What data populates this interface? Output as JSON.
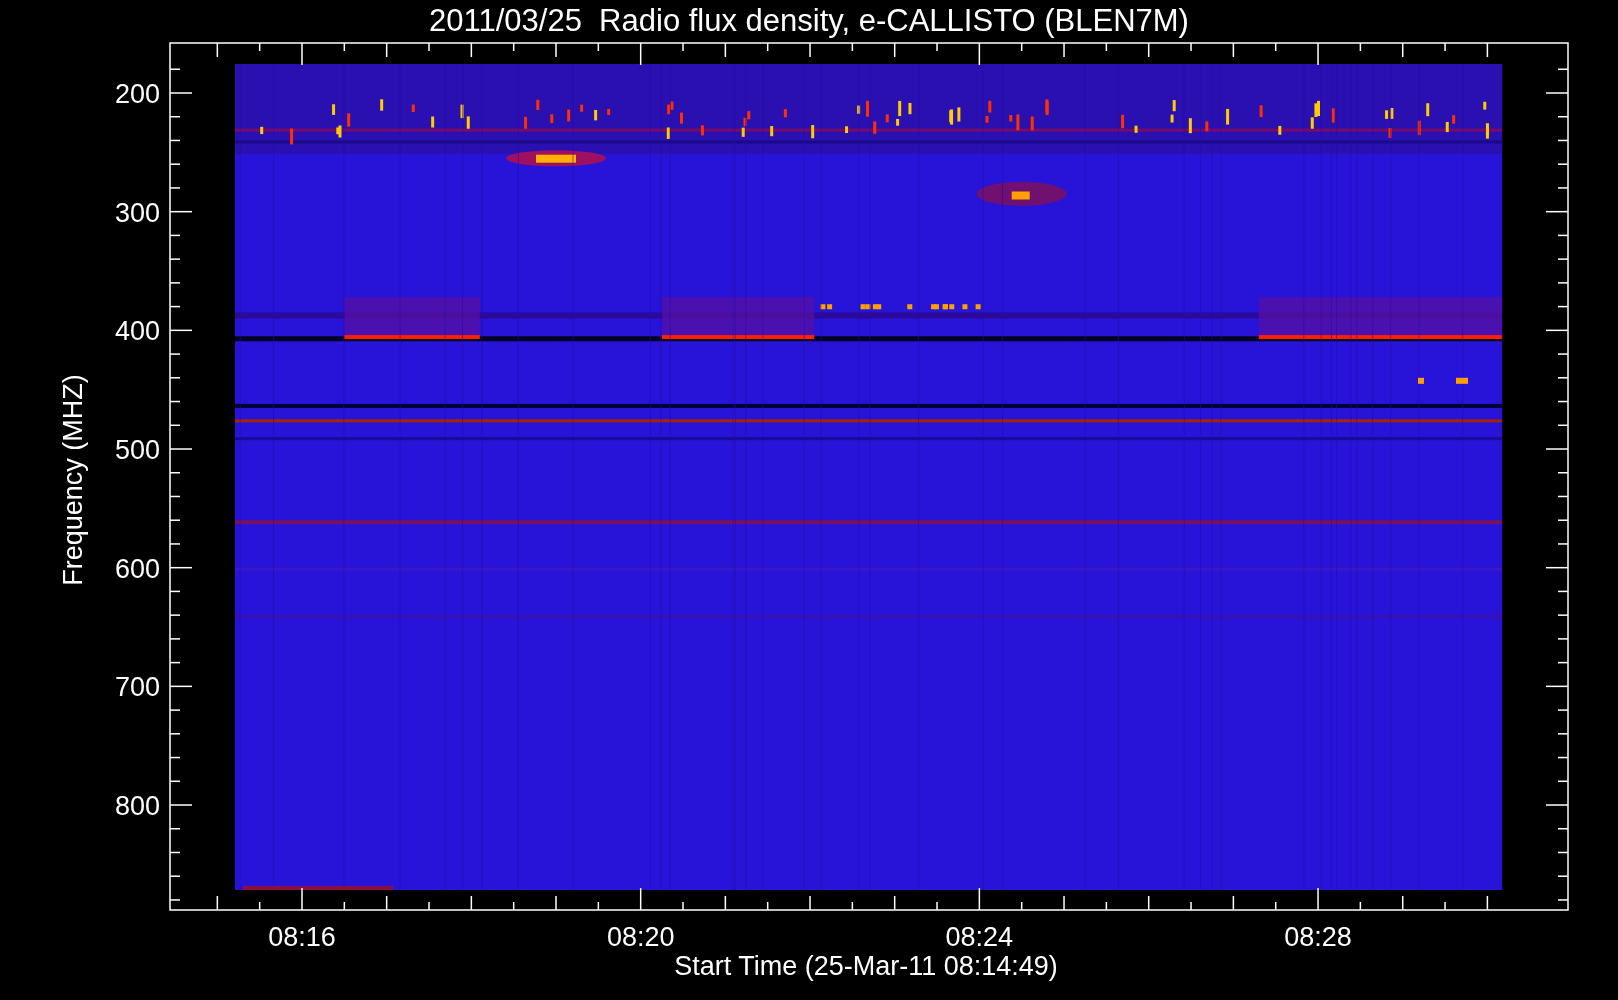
{
  "plot": {
    "title": "2011/03/25  Radio flux density, e-CALLISTO (BLEN7M)",
    "ylabel": "Frequency (MHZ)",
    "xlabel": "Start Time (25-Mar-11 08:14:49)",
    "yticks": [
      "200",
      "300",
      "400",
      "500",
      "600",
      "700",
      "800"
    ],
    "xticks": [
      "08:16",
      "08:20",
      "08:24",
      "08:28"
    ]
  }
}
